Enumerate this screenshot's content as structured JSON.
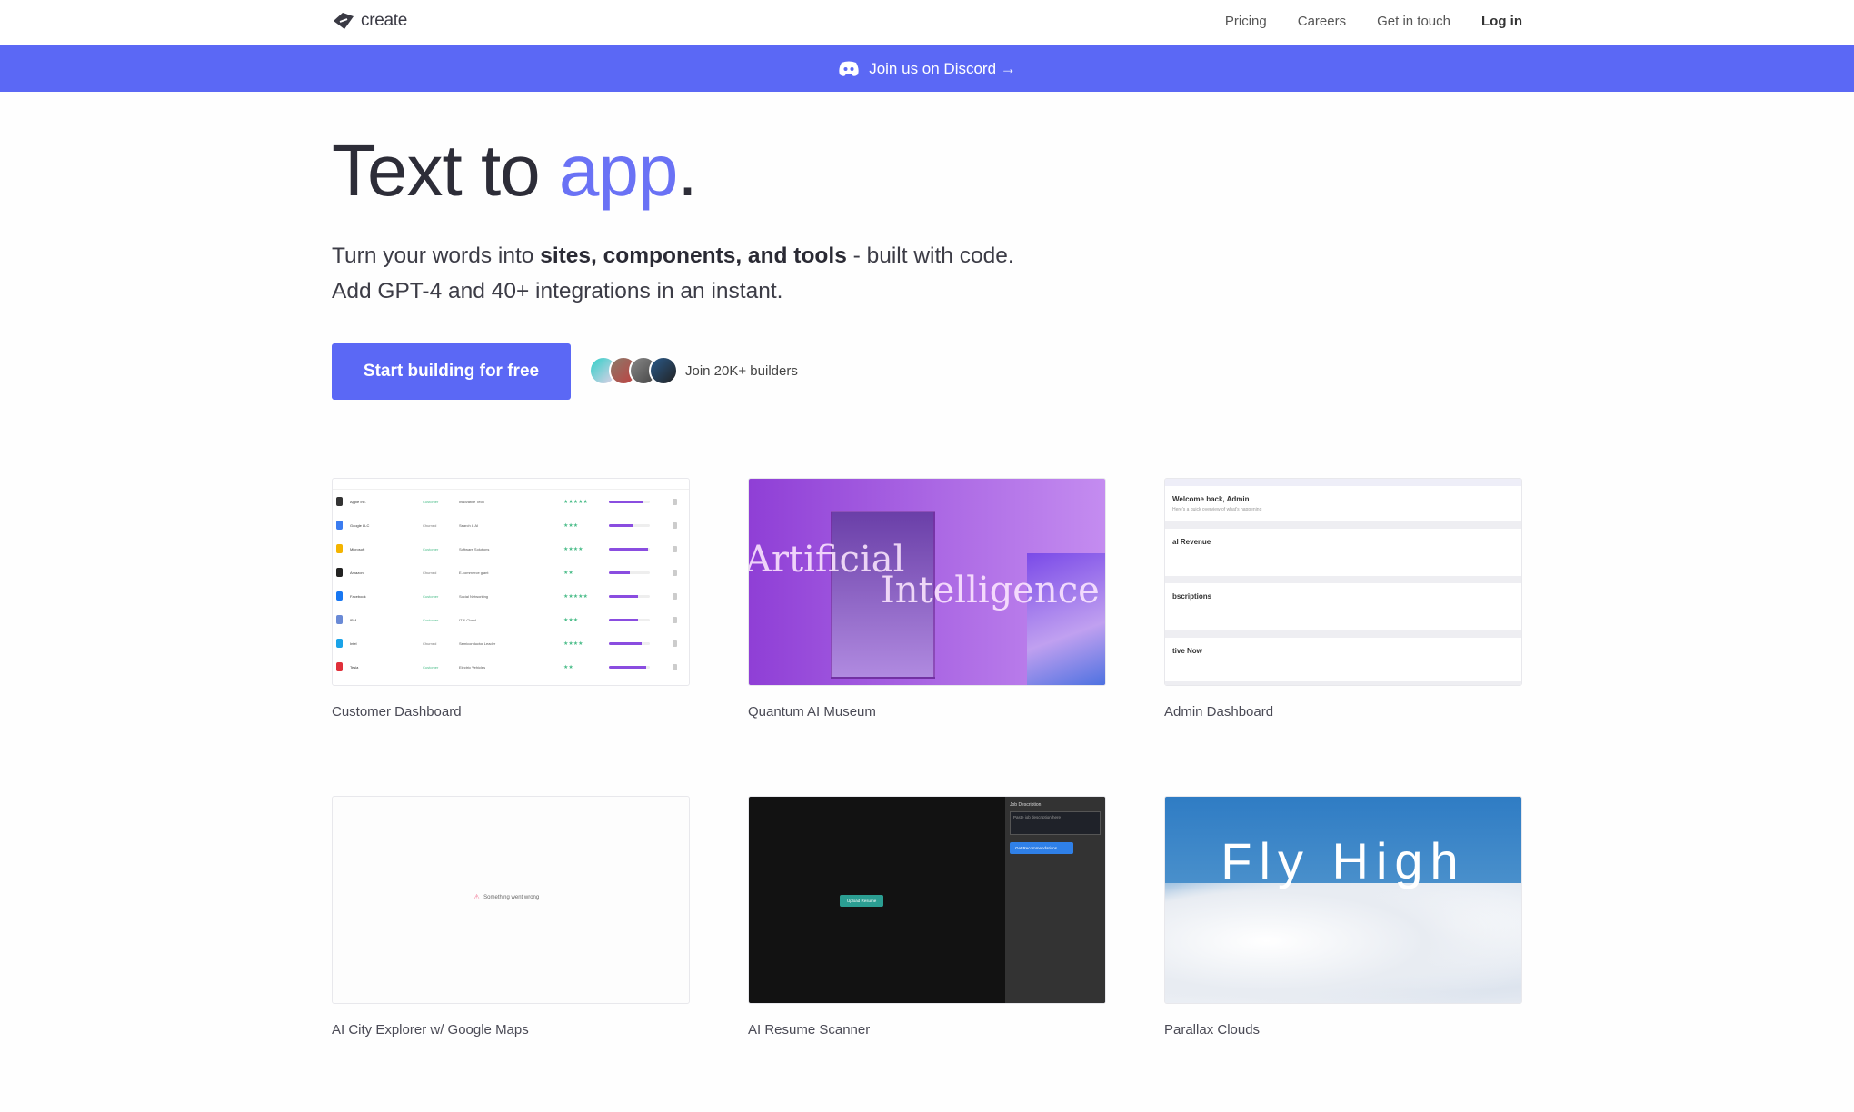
{
  "nav": {
    "logo_text": "create",
    "links": [
      "Pricing",
      "Careers",
      "Get in touch"
    ],
    "login": "Log in"
  },
  "banner": {
    "label": "Join us on Discord →",
    "icon": "discord-icon"
  },
  "hero": {
    "title_plain": "Text to ",
    "title_accent": "app",
    "title_end": ".",
    "sub_line1_pre": "Turn your words into ",
    "sub_line1_bold": "sites, components, and tools",
    "sub_line1_post": " - built with code.",
    "sub_line2": "Add GPT-4 and 40+ integrations in an instant.",
    "cta": "Start building for free",
    "builders": "Join 20K+ builders"
  },
  "colors": {
    "accent": "#5b68f5",
    "title_accent": "#6a72f5"
  },
  "projects": [
    {
      "title": "Customer Dashboard"
    },
    {
      "title": "Quantum AI Museum",
      "preview_words": [
        "Artificial",
        "Intelligence"
      ]
    },
    {
      "title": "Admin Dashboard",
      "preview_sections": [
        "Welcome back, Admin",
        "al Revenue",
        "bscriptions",
        "tive Now"
      ]
    },
    {
      "title": "AI City Explorer w/ Google Maps",
      "preview_error": "Something went wrong"
    },
    {
      "title": "AI Resume Scanner",
      "preview_upload": "Upload Resume",
      "preview_side_label": "Job Description",
      "preview_placeholder": "Paste job description here",
      "preview_button": "Get Recommendations"
    },
    {
      "title": "Parallax Clouds",
      "preview_text": "Fly High"
    }
  ],
  "customer_rows": [
    {
      "name": "Apple Inc.",
      "status": "Customer",
      "role": "Innovative Tech",
      "stars": "★★★★★",
      "bar": 0.85,
      "color": "#333"
    },
    {
      "name": "Google LLC",
      "status": "Churned",
      "role": "Search & AI",
      "stars": "★★★",
      "bar": 0.6,
      "color": "#3b7cf0"
    },
    {
      "name": "Microsoft",
      "status": "Customer",
      "role": "Software Solutions",
      "stars": "★★★★",
      "bar": 0.95,
      "color": "#f4b400"
    },
    {
      "name": "Amazon",
      "status": "Churned",
      "role": "E-commerce giant",
      "stars": "★★",
      "bar": 0.5,
      "color": "#222"
    },
    {
      "name": "Facebook",
      "status": "Customer",
      "role": "Social Networking",
      "stars": "★★★★★",
      "bar": 0.7,
      "color": "#1877f2"
    },
    {
      "name": "IBM",
      "status": "Customer",
      "role": "IT & Cloud",
      "stars": "★★★",
      "bar": 0.7,
      "color": "#6a8ad6"
    },
    {
      "name": "Intel",
      "status": "Churned",
      "role": "Semiconductor Leader",
      "stars": "★★★★",
      "bar": 0.8,
      "color": "#1aa3e8"
    },
    {
      "name": "Tesla",
      "status": "Customer",
      "role": "Electric Vehicles",
      "stars": "★★",
      "bar": 0.9,
      "color": "#e0303a"
    }
  ]
}
